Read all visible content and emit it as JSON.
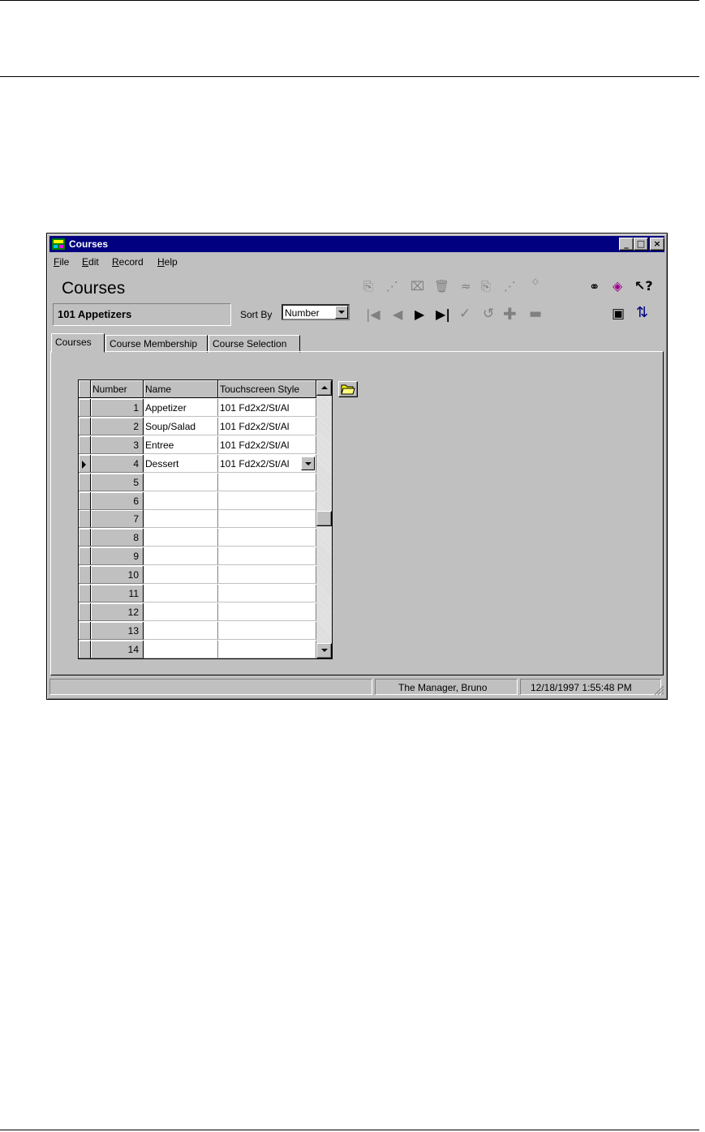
{
  "window": {
    "title": "Courses",
    "caption_buttons": {
      "minimize": "_",
      "maximize": "□",
      "close": "×"
    }
  },
  "menu": [
    {
      "first": "F",
      "rest": "ile"
    },
    {
      "first": "E",
      "rest": "dit"
    },
    {
      "first": "R",
      "rest": "ecord"
    },
    {
      "first": "H",
      "rest": "elp"
    }
  ],
  "header": {
    "title": "Courses",
    "current_record": "101 Appetizers",
    "sort_label": "Sort By",
    "sort_value": "Number"
  },
  "toolbar_icons": [
    "copy-record-icon",
    "paste-record-icon",
    "clear-record-icon",
    "delete-icon",
    "copy-range-icon",
    "paste-range-icon",
    "cut-icon",
    "undo-small-icon",
    "find-icon",
    "help-book-icon",
    "context-help-icon",
    "first-record-icon",
    "previous-record-icon",
    "next-record-icon",
    "last-record-icon",
    "apply-icon",
    "cancel-icon",
    "add-record-icon",
    "remove-record-icon",
    "form-view-icon",
    "table-view-icon"
  ],
  "tabs": [
    {
      "label": "Courses",
      "active": true
    },
    {
      "label": "Course Membership",
      "active": false
    },
    {
      "label": "Course Selection",
      "active": false
    }
  ],
  "grid": {
    "columns": [
      "Number",
      "Name",
      "Touchscreen Style"
    ],
    "rows": [
      {
        "number": "1",
        "name": "Appetizer",
        "style": "101  Fd2x2/St/Al"
      },
      {
        "number": "2",
        "name": "Soup/Salad",
        "style": "101  Fd2x2/St/Al"
      },
      {
        "number": "3",
        "name": "Entree",
        "style": "101  Fd2x2/St/Al"
      },
      {
        "number": "4",
        "name": "Dessert",
        "style": "101  Fd2x2/St/Al",
        "current": true
      },
      {
        "number": "5",
        "name": "",
        "style": ""
      },
      {
        "number": "6",
        "name": "",
        "style": ""
      },
      {
        "number": "7",
        "name": "",
        "style": ""
      },
      {
        "number": "8",
        "name": "",
        "style": ""
      },
      {
        "number": "9",
        "name": "",
        "style": ""
      },
      {
        "number": "10",
        "name": "",
        "style": ""
      },
      {
        "number": "11",
        "name": "",
        "style": ""
      },
      {
        "number": "12",
        "name": "",
        "style": ""
      },
      {
        "number": "13",
        "name": "",
        "style": ""
      },
      {
        "number": "14",
        "name": "",
        "style": ""
      }
    ]
  },
  "status": {
    "message": "",
    "user": "The Manager, Bruno",
    "datetime": "12/18/1997 1:55:48 PM"
  },
  "colors": {
    "titlebar": "#000080",
    "face": "#c0c0c0"
  }
}
